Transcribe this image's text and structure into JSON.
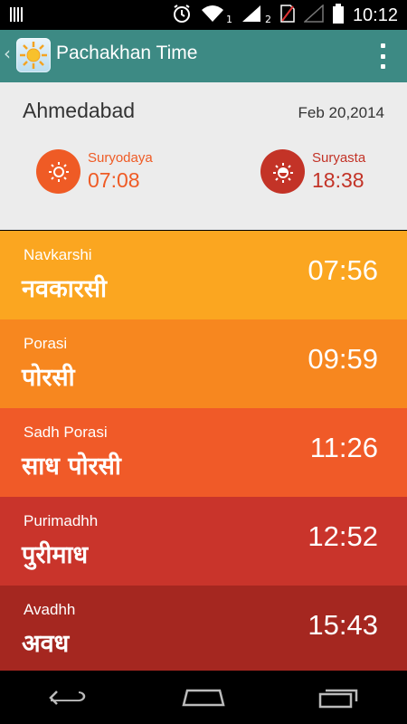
{
  "status_bar": {
    "time": "10:12",
    "sim1_label": "1",
    "sim2_label": "2",
    "icons": [
      "notification-icon",
      "alarm-icon",
      "wifi-icon",
      "signal-icon",
      "battery-icon"
    ]
  },
  "action_bar": {
    "title": "Pachakhan Time",
    "icon": "sun-app-icon",
    "menu_icon": "overflow-menu-icon"
  },
  "location": {
    "city": "Ahmedabad",
    "date": "Feb 20,2014"
  },
  "sunrise": {
    "label": "Suryodaya",
    "time": "07:08",
    "color": "#ef5b25"
  },
  "sunset": {
    "label": "Suryasta",
    "time": "18:38",
    "color": "#c33327"
  },
  "rows": [
    {
      "en": "Navkarshi",
      "hi": "नवकारसी",
      "time": "07:56",
      "color": "#fba620"
    },
    {
      "en": "Porasi",
      "hi": "पोरसी",
      "time": "09:59",
      "color": "#f7871f"
    },
    {
      "en": "Sadh Porasi",
      "hi": "साध पोरसी",
      "time": "11:26",
      "color": "#f05a28"
    },
    {
      "en": "Purimadhh",
      "hi": "पुरीमाध",
      "time": "12:52",
      "color": "#c9342b"
    },
    {
      "en": "Avadhh",
      "hi": "अवध",
      "time": "15:43",
      "color": "#a52720"
    }
  ],
  "nav_bar": [
    "back-icon",
    "home-icon",
    "recent-apps-icon"
  ]
}
